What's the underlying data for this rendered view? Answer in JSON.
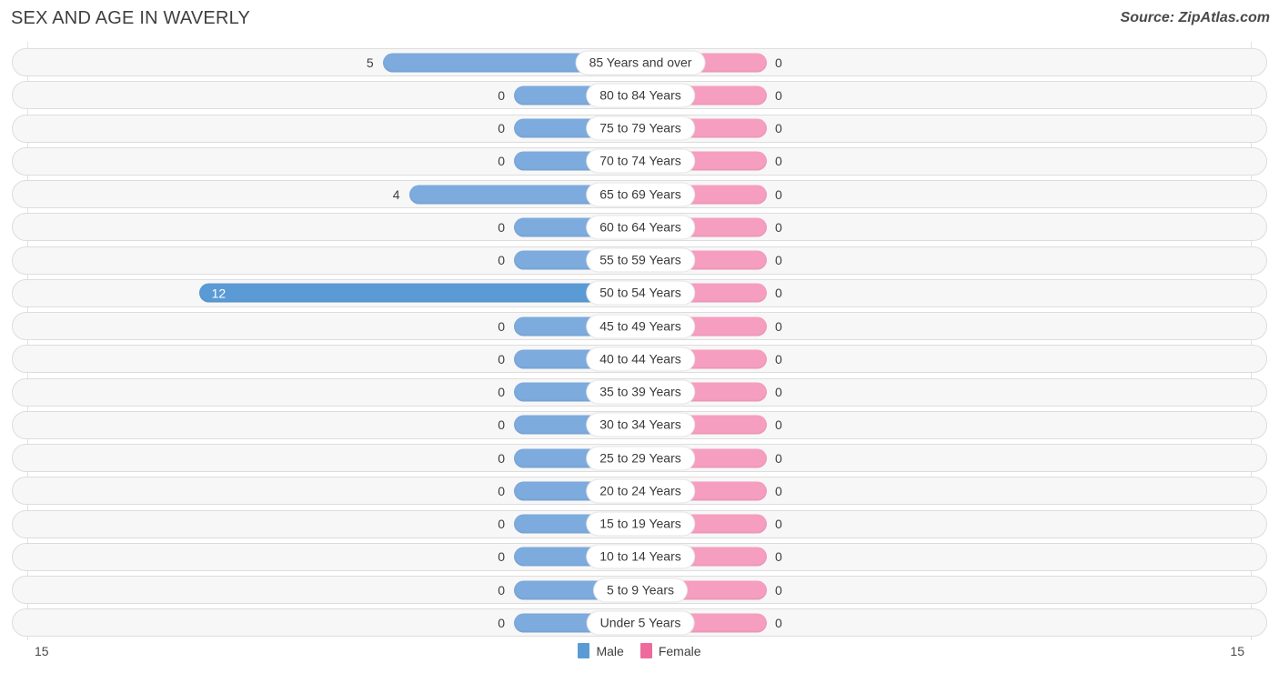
{
  "header": {
    "title": "SEX AND AGE IN WAVERLY",
    "source": "Source: ZipAtlas.com"
  },
  "legend": {
    "male_label": "Male",
    "female_label": "Female",
    "male_color": "#5b9bd5",
    "female_color": "#ef6a9c"
  },
  "axis": {
    "left_tick": "15",
    "right_tick": "15"
  },
  "chart_data": {
    "type": "bar",
    "subtype": "population-pyramid",
    "title": "SEX AND AGE IN WAVERLY",
    "xlabel": "",
    "ylabel": "",
    "xlim": [
      0,
      15
    ],
    "grid": false,
    "legend_position": "bottom-center",
    "categories": [
      "85 Years and over",
      "80 to 84 Years",
      "75 to 79 Years",
      "70 to 74 Years",
      "65 to 69 Years",
      "60 to 64 Years",
      "55 to 59 Years",
      "50 to 54 Years",
      "45 to 49 Years",
      "40 to 44 Years",
      "35 to 39 Years",
      "30 to 34 Years",
      "25 to 29 Years",
      "20 to 24 Years",
      "15 to 19 Years",
      "10 to 14 Years",
      "5 to 9 Years",
      "Under 5 Years"
    ],
    "series": [
      {
        "name": "Male",
        "direction": "left",
        "color": "#5b9bd5",
        "values": [
          5,
          0,
          0,
          0,
          4,
          0,
          0,
          12,
          0,
          0,
          0,
          0,
          0,
          0,
          0,
          0,
          0,
          0
        ]
      },
      {
        "name": "Female",
        "direction": "right",
        "color": "#ef6a9c",
        "values": [
          0,
          0,
          0,
          0,
          0,
          0,
          0,
          0,
          0,
          0,
          0,
          0,
          0,
          0,
          0,
          0,
          0,
          0
        ]
      }
    ]
  },
  "rows": [
    {
      "label": "85 Years and over",
      "male": "5",
      "female": "0"
    },
    {
      "label": "80 to 84 Years",
      "male": "0",
      "female": "0"
    },
    {
      "label": "75 to 79 Years",
      "male": "0",
      "female": "0"
    },
    {
      "label": "70 to 74 Years",
      "male": "0",
      "female": "0"
    },
    {
      "label": "65 to 69 Years",
      "male": "4",
      "female": "0"
    },
    {
      "label": "60 to 64 Years",
      "male": "0",
      "female": "0"
    },
    {
      "label": "55 to 59 Years",
      "male": "0",
      "female": "0"
    },
    {
      "label": "50 to 54 Years",
      "male": "12",
      "female": "0"
    },
    {
      "label": "45 to 49 Years",
      "male": "0",
      "female": "0"
    },
    {
      "label": "40 to 44 Years",
      "male": "0",
      "female": "0"
    },
    {
      "label": "35 to 39 Years",
      "male": "0",
      "female": "0"
    },
    {
      "label": "30 to 34 Years",
      "male": "0",
      "female": "0"
    },
    {
      "label": "25 to 29 Years",
      "male": "0",
      "female": "0"
    },
    {
      "label": "20 to 24 Years",
      "male": "0",
      "female": "0"
    },
    {
      "label": "15 to 19 Years",
      "male": "0",
      "female": "0"
    },
    {
      "label": "10 to 14 Years",
      "male": "0",
      "female": "0"
    },
    {
      "label": "5 to 9 Years",
      "male": "0",
      "female": "0"
    },
    {
      "label": "Under 5 Years",
      "male": "0",
      "female": "0"
    }
  ]
}
